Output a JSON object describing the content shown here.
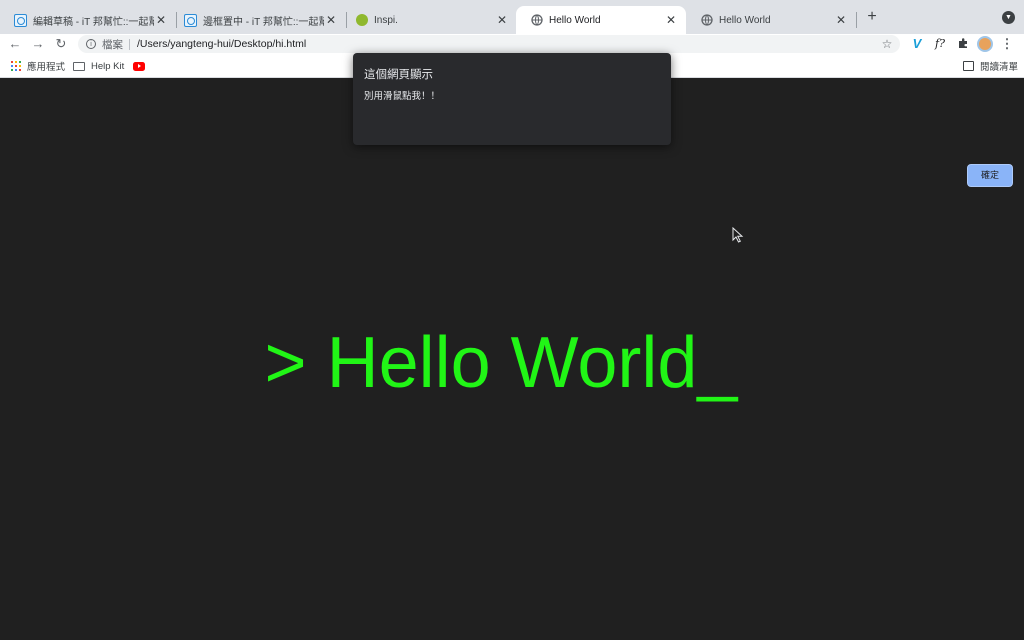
{
  "browser": {
    "tabs": [
      {
        "title": "編輯草稿 - iT 邦幫忙::一起幫忙解",
        "favicon": "ithome-icon"
      },
      {
        "title": "邊框置中 - iT 邦幫忙::一起幫忙解",
        "favicon": "ithome-icon"
      },
      {
        "title": "Inspi.",
        "favicon": "inspi-icon"
      },
      {
        "title": "Hello World",
        "favicon": "globe-icon",
        "active": true
      },
      {
        "title": "Hello World",
        "favicon": "globe-icon"
      }
    ],
    "address_bar": {
      "scheme_label": "檔案",
      "url": "/Users/yangteng-hui/Desktop/hi.html"
    },
    "bookmarks": [
      {
        "label": "應用程式",
        "icon": "apps-grid-icon"
      },
      {
        "label": "Help Kit",
        "icon": "folder-icon"
      },
      {
        "label": "",
        "icon": "youtube-icon"
      }
    ],
    "reading_list_label": "閱讀清單",
    "extension_fx_label": "f?"
  },
  "page": {
    "headline": "> Hello World_",
    "headline_color": "#21f516",
    "background_color": "#202020"
  },
  "dialog": {
    "title": "這個網頁顯示",
    "message": "別用滑鼠點我！！",
    "ok_label": "確定"
  }
}
